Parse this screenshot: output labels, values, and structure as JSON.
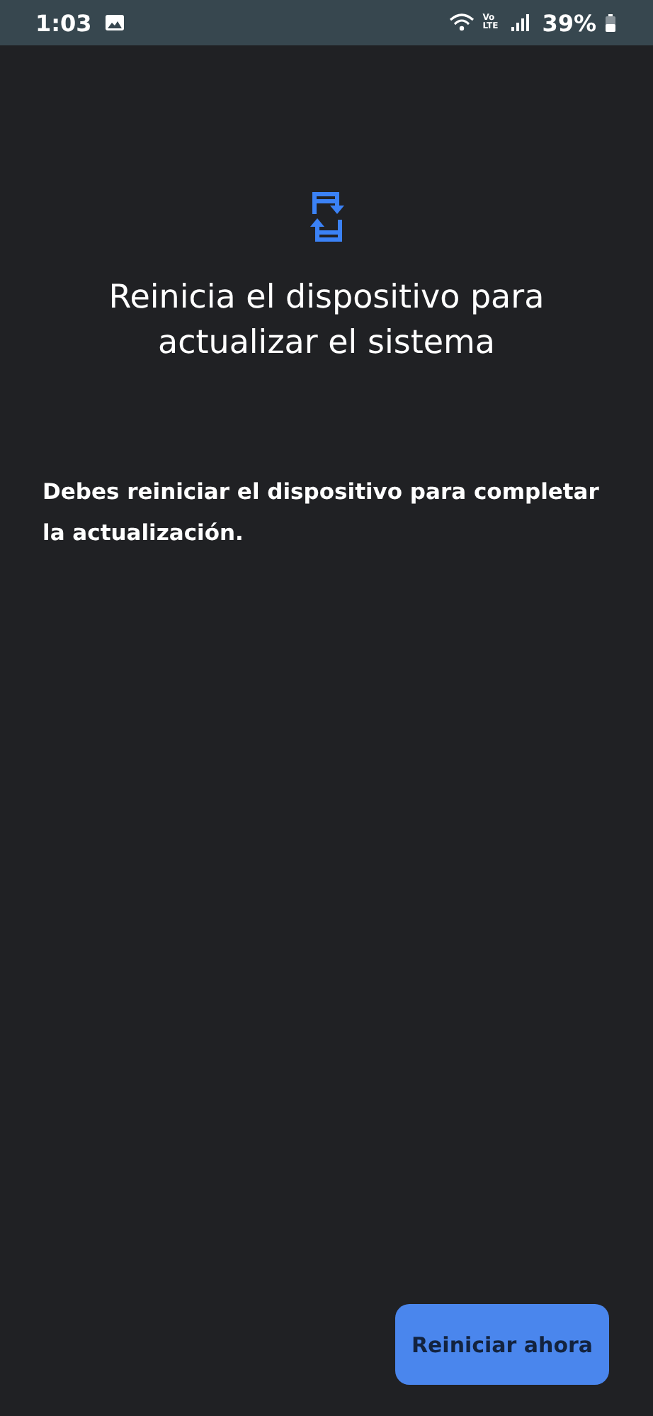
{
  "status_bar": {
    "time": "1:03",
    "network": "Vo LTE",
    "battery": "39%"
  },
  "title": "Reinicia el dispositivo para actualizar el sistema",
  "message": "Debes reiniciar el dispositivo para completar la actualización.",
  "buttons": [
    "Reiniciar ahora"
  ]
}
